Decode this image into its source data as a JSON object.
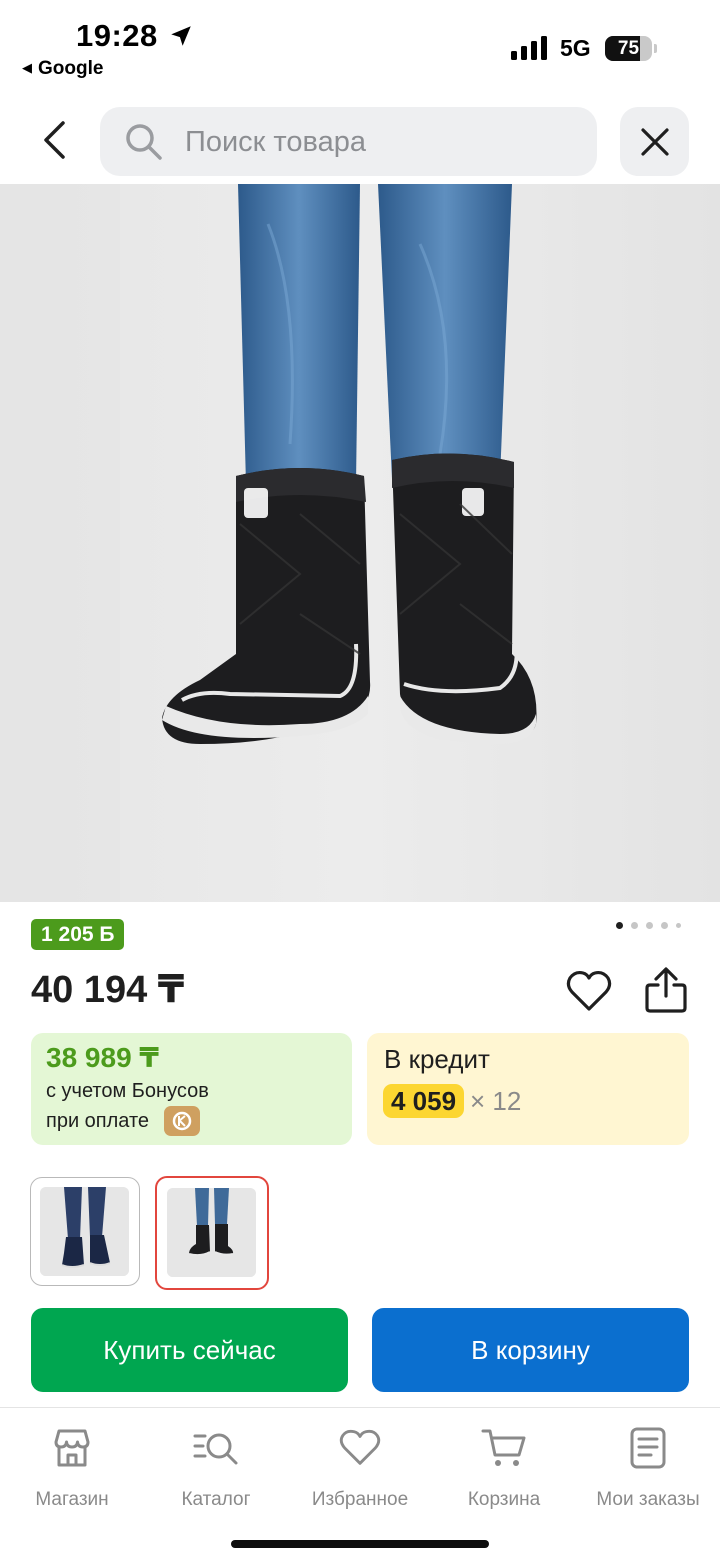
{
  "status_bar": {
    "time": "19:28",
    "back_app": "Google",
    "network": "5G",
    "battery": "75",
    "battery_level": 0.75
  },
  "search": {
    "placeholder": "Поиск товара"
  },
  "product": {
    "bonus_badge": "1 205 Б",
    "price": "40 194 ₸",
    "image_count": 5,
    "active_image": 1
  },
  "bonus_offer": {
    "price": "38 989 ₸",
    "note_line1": "с учетом Бонусов",
    "note_line2": "при оплате"
  },
  "credit_offer": {
    "title": "В кредит",
    "monthly": "4 059",
    "months": "× 12"
  },
  "variants": [
    {
      "name": "navy",
      "selected": false
    },
    {
      "name": "black",
      "selected": true
    }
  ],
  "actions": {
    "buy_now": "Купить сейчас",
    "add_to_cart": "В корзину"
  },
  "tabbar": {
    "items": [
      {
        "label": "Магазин",
        "icon": "shop-icon"
      },
      {
        "label": "Каталог",
        "icon": "catalog-icon"
      },
      {
        "label": "Избранное",
        "icon": "heart-icon"
      },
      {
        "label": "Корзина",
        "icon": "cart-icon"
      },
      {
        "label": "Мои заказы",
        "icon": "orders-icon"
      }
    ]
  },
  "colors": {
    "bonus_green": "#4c9b1c",
    "buy_green": "#00a650",
    "cart_blue": "#0b6fcf",
    "credit_yellow": "#fcd631",
    "selected_border": "#e2463d"
  }
}
